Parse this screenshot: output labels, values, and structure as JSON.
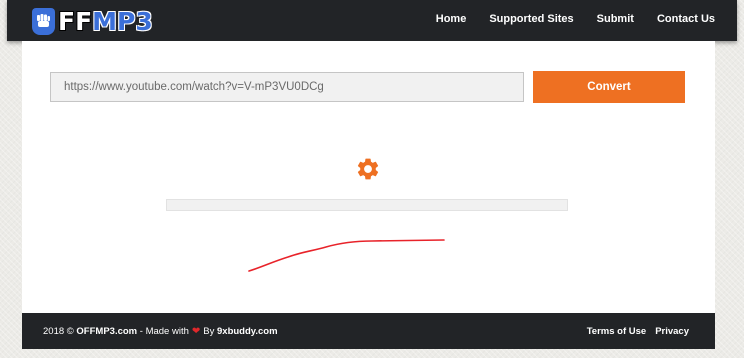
{
  "header": {
    "logo": {
      "text_white": "FF",
      "text_blue": "MP3",
      "icon": "fist-icon"
    },
    "nav": [
      {
        "label": "Home"
      },
      {
        "label": "Supported Sites"
      },
      {
        "label": "Submit"
      },
      {
        "label": "Contact Us"
      }
    ]
  },
  "converter": {
    "url_value": "https://www.youtube.com/watch?v=V-mP3VU0DCg",
    "convert_label": "Convert",
    "status_icon": "gear-icon",
    "progress_fraction": 0
  },
  "footer": {
    "year": "2018 © ",
    "site": "OFFMP3.com",
    "made_with": " - Made with",
    "heart_icon": "heart-icon",
    "by": "By ",
    "author": "9xbuddy.com",
    "links": [
      {
        "label": "Terms of Use"
      },
      {
        "label": "Privacy"
      }
    ]
  },
  "colors": {
    "accent": "#ee7022",
    "brand_blue": "#3b6fd8",
    "dark_bar": "#222427",
    "annotation_red": "#e8232a"
  }
}
